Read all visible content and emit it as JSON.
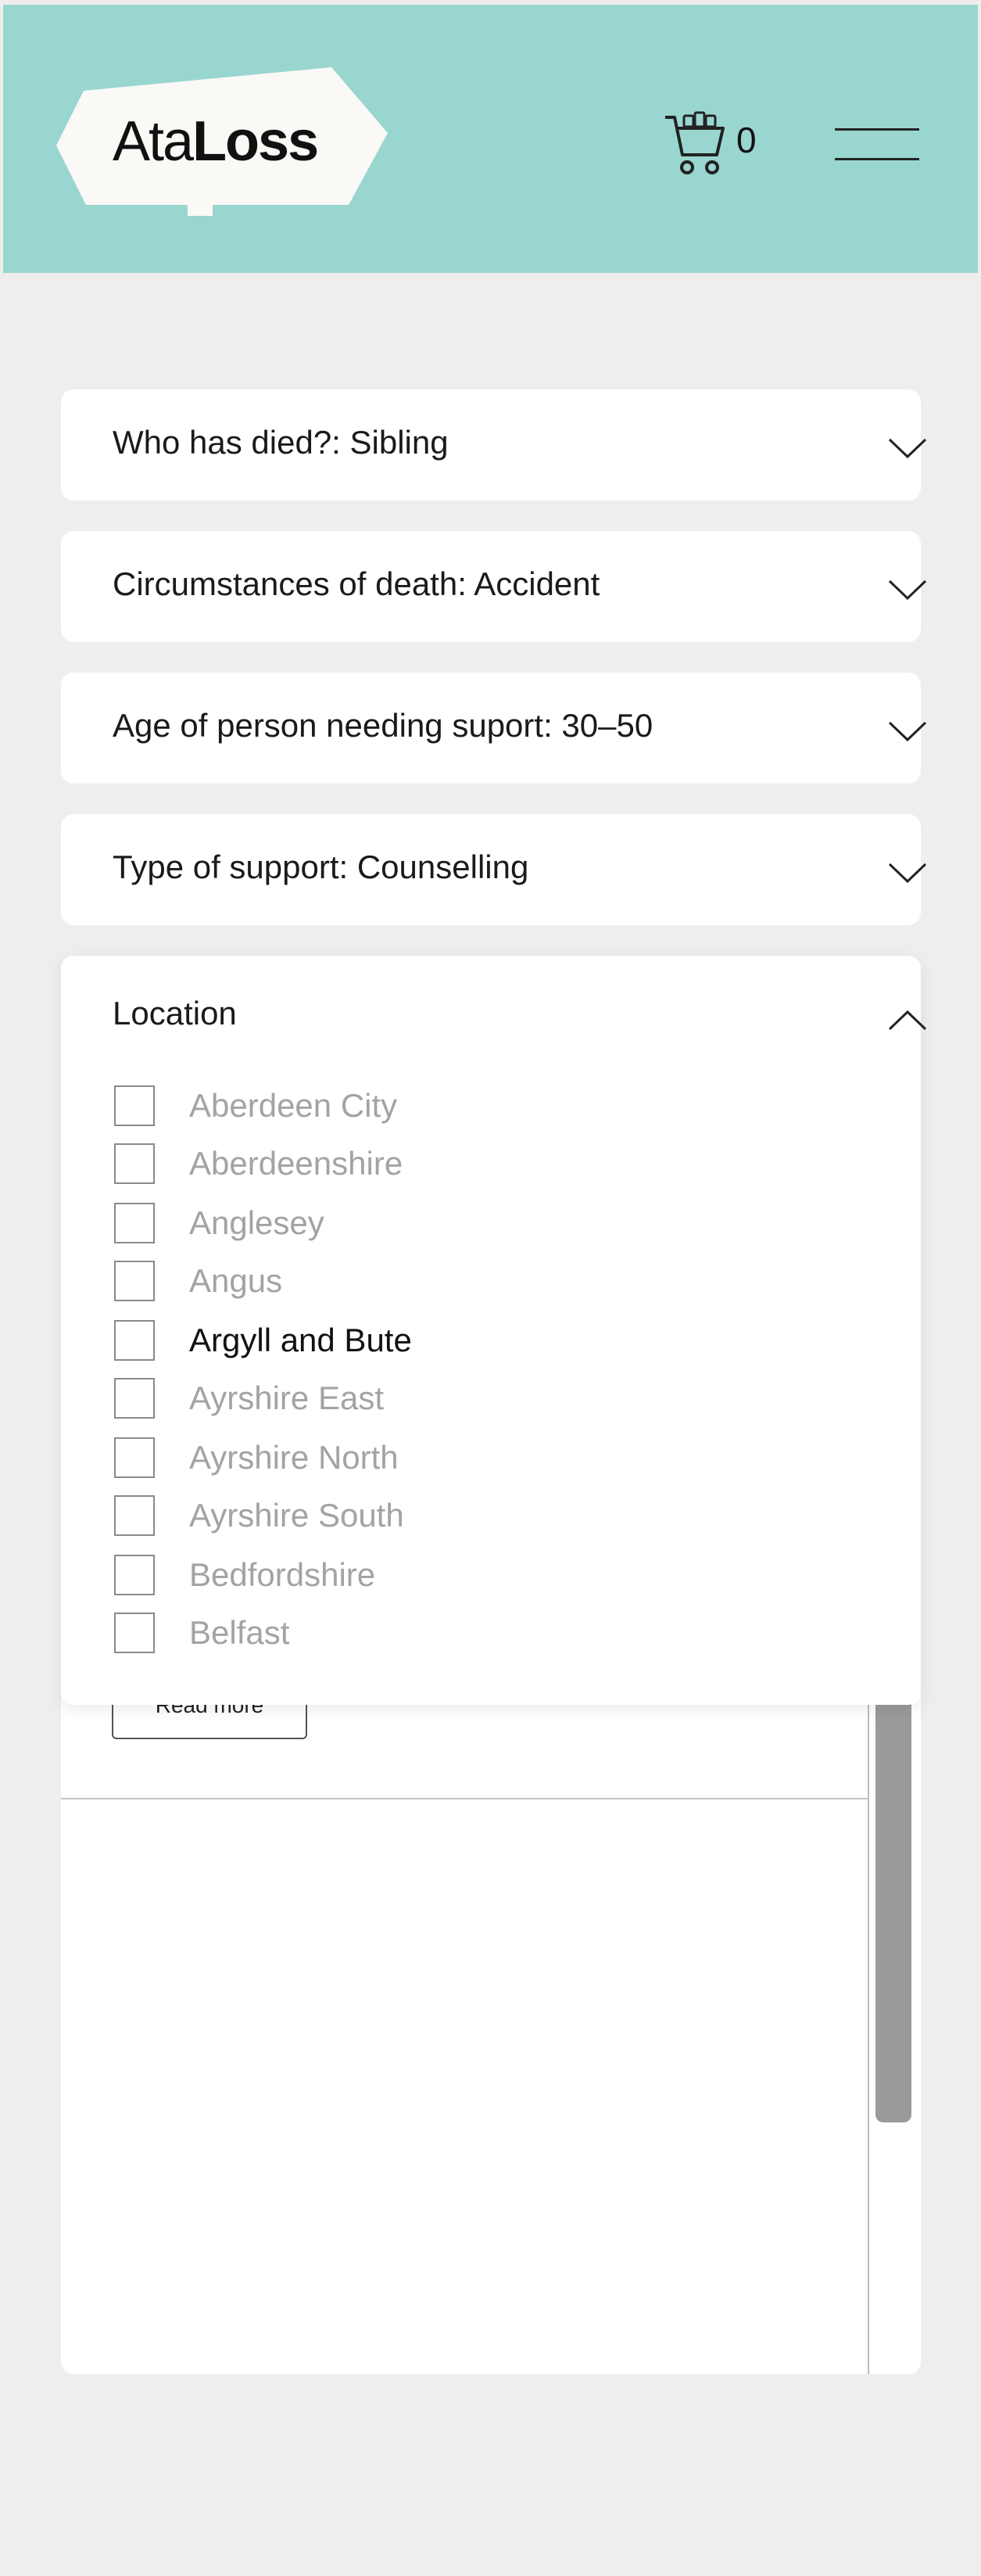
{
  "header": {
    "logo": {
      "text_light": "Ata",
      "text_bold": "Loss"
    },
    "cart": {
      "icon": "cart-icon",
      "count": "0"
    },
    "menu": {
      "icon": "hamburger-menu-icon"
    }
  },
  "filters": [
    {
      "label": "Who has died?: Sibling"
    },
    {
      "label": "Circumstances of death: Accident"
    },
    {
      "label": "Age of person needing suport: 30–50"
    },
    {
      "label": "Type of support: Counselling"
    }
  ],
  "location": {
    "label": "Location",
    "options": [
      {
        "label": "Aberdeen City",
        "checked": false
      },
      {
        "label": "Aberdeenshire",
        "checked": false
      },
      {
        "label": "Anglesey",
        "checked": false
      },
      {
        "label": "Angus",
        "checked": false
      },
      {
        "label": "Argyll and Bute",
        "checked": false,
        "highlighted": true
      },
      {
        "label": "Ayrshire East",
        "checked": false
      },
      {
        "label": "Ayrshire North",
        "checked": false
      },
      {
        "label": "Ayrshire South",
        "checked": false
      },
      {
        "label": "Bedfordshire",
        "checked": false
      },
      {
        "label": "Belfast",
        "checked": false
      }
    ]
  },
  "result": {
    "read_more_label": "Read more"
  },
  "colors": {
    "header_bg": "#9ad6d0",
    "page_bg": "#efeeec"
  }
}
